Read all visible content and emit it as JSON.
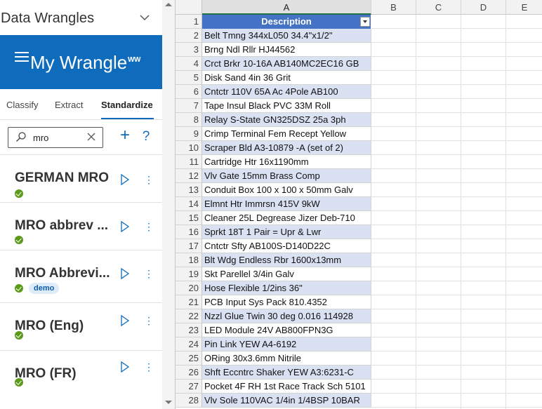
{
  "pane": {
    "title": "Data Wrangles",
    "collapse_icon": "chevron-down-icon",
    "close_icon": "close-icon",
    "banner": {
      "text": "My Wrangle",
      "superscript": "WW",
      "color": "#0f6cbd"
    },
    "tabs": [
      {
        "label": "Classify",
        "active": false
      },
      {
        "label": "Extract",
        "active": false
      },
      {
        "label": "Standardize",
        "active": true
      }
    ],
    "search": {
      "value": "mro",
      "placeholder": ""
    },
    "wrangles": [
      {
        "name": "GERMAN MRO",
        "status": "ok",
        "badge": ""
      },
      {
        "name": "MRO abbrev ...",
        "status": "ok",
        "badge": ""
      },
      {
        "name": "MRO Abbrevi...",
        "status": "ok",
        "badge": "demo"
      },
      {
        "name": "MRO (Eng)",
        "status": "ok",
        "badge": ""
      },
      {
        "name": "MRO (FR)",
        "status": "ok",
        "badge": ""
      }
    ]
  },
  "sheet": {
    "columns": [
      "A",
      "B",
      "C",
      "D",
      "E"
    ],
    "header_cell": "Description",
    "header_color": "#4472c4",
    "band_color": "#d9e1f2",
    "rows": [
      {
        "n": "1",
        "a": ""
      },
      {
        "n": "2",
        "a": "Belt Tmng 344xL050 34.4\"x1/2\""
      },
      {
        "n": "3",
        "a": "Brng Ndl Rllr HJ44562"
      },
      {
        "n": "4",
        "a": "Crct Brkr 10-16A AB140MC2EC16 GB"
      },
      {
        "n": "5",
        "a": "Disk Sand 4in 36 Grit"
      },
      {
        "n": "6",
        "a": "Cntctr 110V 65A Ac 4Pole AB100"
      },
      {
        "n": "7",
        "a": "Tape Insul Black PVC 33M Roll"
      },
      {
        "n": "8",
        "a": "Relay S-State GN325DSZ 25a 3ph"
      },
      {
        "n": "9",
        "a": "Crimp Terminal Fem Recept Yellow"
      },
      {
        "n": "10",
        "a": "Scraper Bld A3-10879 -A (set of 2)"
      },
      {
        "n": "11",
        "a": "Cartridge Htr 16x1190mm"
      },
      {
        "n": "12",
        "a": "Vlv Gate 15mm Brass Comp"
      },
      {
        "n": "13",
        "a": "Conduit Box 100 x 100 x 50mm Galv"
      },
      {
        "n": "14",
        "a": "Elmnt Htr Immrsn 415V 9kW"
      },
      {
        "n": "15",
        "a": "Cleaner 25L Degrease Jizer Deb-710"
      },
      {
        "n": "16",
        "a": "Sprkt 18T 1 Pair = Upr & Lwr"
      },
      {
        "n": "17",
        "a": "Cntctr Sfty AB100S-D140D22C"
      },
      {
        "n": "18",
        "a": "Blt Wdg Endless Rbr 1600x13mm"
      },
      {
        "n": "19",
        "a": "Skt Parellel 3/4in Galv"
      },
      {
        "n": "20",
        "a": "Hose Flexible 1/2ins 36\""
      },
      {
        "n": "21",
        "a": "PCB Input Sys Pack 810.4352"
      },
      {
        "n": "22",
        "a": "Nzzl Glue Twin 30 deg 0.016 114928"
      },
      {
        "n": "23",
        "a": "LED Module 24V AB800FPN3G"
      },
      {
        "n": "24",
        "a": "Pin Link YEW A4-6192"
      },
      {
        "n": "25",
        "a": "ORing 30x3.6mm Nitrile"
      },
      {
        "n": "26",
        "a": "Shft Eccntrc Shaker YEW A3:6231-C"
      },
      {
        "n": "27",
        "a": "Pocket 4F RH 1st Race Track Sch 5101"
      },
      {
        "n": "28",
        "a": "Vlv Sole 110VAC 1/4in 1/4BSP 10BAR"
      }
    ]
  }
}
